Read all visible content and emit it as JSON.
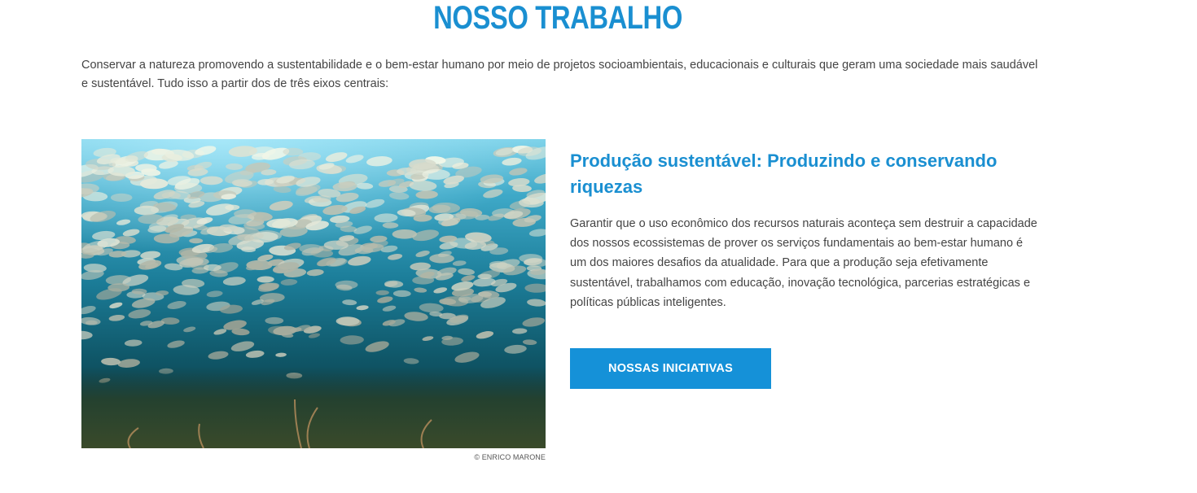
{
  "section": {
    "title": "NOSSO TRABALHO",
    "intro": "Conservar a natureza promovendo a sustentabilidade e o bem-estar humano por meio de projetos socioambientais, educacionais e culturais que geram uma sociedade mais saudável e sustentável. Tudo isso a partir dos de três eixos centrais:"
  },
  "feature": {
    "photo_description": "underwater school of fish",
    "photo_credit": "© ENRICO MARONE",
    "title": "Produção sustentável: Produzindo e conservando riquezas",
    "body": "Garantir que o uso econômico dos recursos naturais aconteça sem destruir a capacidade dos nossos ecossistemas de prover os serviços fundamentais ao bem-estar humano é um dos maiores desafios da atualidade. Para que a produção seja efetivamente sustentável, trabalhamos com educação, inovação tecnológica, parcerias estratégicas e políticas públicas inteligentes.",
    "button_label": "NOSSAS INICIATIVAS"
  },
  "colors": {
    "accent": "#1a8fd1",
    "button": "#1591d8",
    "text": "#444444"
  }
}
